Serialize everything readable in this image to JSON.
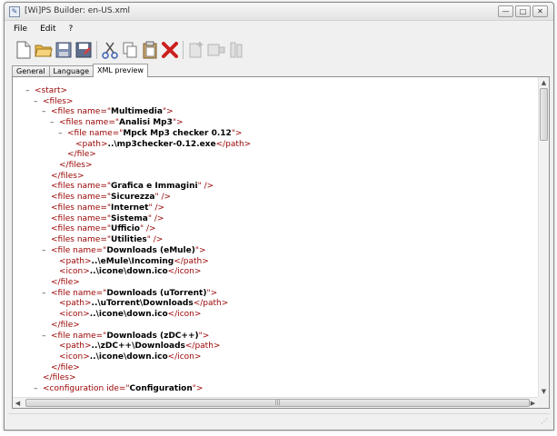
{
  "window": {
    "title": "[Wi]PS Builder: en-US.xml",
    "buttons": {
      "minimize": "—",
      "maximize": "□",
      "close": "✕"
    }
  },
  "menu": {
    "file": "File",
    "edit": "Edit",
    "help": "?"
  },
  "toolbar": {
    "icons": [
      "new-file-icon",
      "open-folder-icon",
      "save-icon",
      "save-as-icon",
      "cut-icon",
      "copy-icon",
      "paste-icon",
      "delete-icon",
      "add-item-icon",
      "add-child-icon",
      "properties-icon"
    ],
    "delete_color": "#cc1f1f"
  },
  "tabs": {
    "general": "General",
    "language": "Language",
    "xml_preview": "XML preview"
  },
  "xml_lines": [
    {
      "indent": 0,
      "toggle": "–",
      "parts": [
        [
          "tag",
          "<start>"
        ]
      ]
    },
    {
      "indent": 1,
      "toggle": "–",
      "parts": [
        [
          "tag",
          "<files>"
        ]
      ]
    },
    {
      "indent": 2,
      "toggle": "–",
      "parts": [
        [
          "tag",
          "<files "
        ],
        [
          "attr",
          "name=\""
        ],
        [
          "val",
          "Multimedia"
        ],
        [
          "attr",
          "\">"
        ]
      ]
    },
    {
      "indent": 3,
      "toggle": "–",
      "parts": [
        [
          "tag",
          "<files "
        ],
        [
          "attr",
          "name=\""
        ],
        [
          "val",
          "Analisi Mp3"
        ],
        [
          "attr",
          "\">"
        ]
      ]
    },
    {
      "indent": 4,
      "toggle": "–",
      "parts": [
        [
          "tag",
          "<file "
        ],
        [
          "attr",
          "name=\""
        ],
        [
          "val",
          "Mpck Mp3 checker 0.12"
        ],
        [
          "attr",
          "\">"
        ]
      ]
    },
    {
      "indent": 5,
      "toggle": "",
      "parts": [
        [
          "tag",
          "<path>"
        ],
        [
          "txt",
          "..\\mp3checker-0.12.exe"
        ],
        [
          "tag",
          "</path>"
        ]
      ]
    },
    {
      "indent": 4,
      "toggle": "",
      "parts": [
        [
          "tag",
          "</file>"
        ]
      ]
    },
    {
      "indent": 3,
      "toggle": "",
      "parts": [
        [
          "tag",
          "</files>"
        ]
      ]
    },
    {
      "indent": 2,
      "toggle": "",
      "parts": [
        [
          "tag",
          "</files>"
        ]
      ]
    },
    {
      "indent": 2,
      "toggle": "",
      "parts": [
        [
          "tag",
          "<files "
        ],
        [
          "attr",
          "name=\""
        ],
        [
          "val",
          "Grafica e Immagini"
        ],
        [
          "attr",
          "\" />"
        ]
      ]
    },
    {
      "indent": 2,
      "toggle": "",
      "parts": [
        [
          "tag",
          "<files "
        ],
        [
          "attr",
          "name=\""
        ],
        [
          "val",
          "Sicurezza"
        ],
        [
          "attr",
          "\" />"
        ]
      ]
    },
    {
      "indent": 2,
      "toggle": "",
      "parts": [
        [
          "tag",
          "<files "
        ],
        [
          "attr",
          "name=\""
        ],
        [
          "val",
          "Internet"
        ],
        [
          "attr",
          "\" />"
        ]
      ]
    },
    {
      "indent": 2,
      "toggle": "",
      "parts": [
        [
          "tag",
          "<files "
        ],
        [
          "attr",
          "name=\""
        ],
        [
          "val",
          "Sistema"
        ],
        [
          "attr",
          "\" />"
        ]
      ]
    },
    {
      "indent": 2,
      "toggle": "",
      "parts": [
        [
          "tag",
          "<files "
        ],
        [
          "attr",
          "name=\""
        ],
        [
          "val",
          "Ufficio"
        ],
        [
          "attr",
          "\" />"
        ]
      ]
    },
    {
      "indent": 2,
      "toggle": "",
      "parts": [
        [
          "tag",
          "<files "
        ],
        [
          "attr",
          "name=\""
        ],
        [
          "val",
          "Utilities"
        ],
        [
          "attr",
          "\" />"
        ]
      ]
    },
    {
      "indent": 2,
      "toggle": "–",
      "parts": [
        [
          "tag",
          "<file "
        ],
        [
          "attr",
          "name=\""
        ],
        [
          "val",
          "Downloads (eMule)"
        ],
        [
          "attr",
          "\">"
        ]
      ]
    },
    {
      "indent": 3,
      "toggle": "",
      "parts": [
        [
          "tag",
          "<path>"
        ],
        [
          "txt",
          "..\\eMule\\Incoming"
        ],
        [
          "tag",
          "</path>"
        ]
      ]
    },
    {
      "indent": 3,
      "toggle": "",
      "parts": [
        [
          "tag",
          "<icon>"
        ],
        [
          "txt",
          "..\\icone\\down.ico"
        ],
        [
          "tag",
          "</icon>"
        ]
      ]
    },
    {
      "indent": 2,
      "toggle": "",
      "parts": [
        [
          "tag",
          "</file>"
        ]
      ]
    },
    {
      "indent": 2,
      "toggle": "–",
      "parts": [
        [
          "tag",
          "<file "
        ],
        [
          "attr",
          "name=\""
        ],
        [
          "val",
          "Downloads (uTorrent)"
        ],
        [
          "attr",
          "\">"
        ]
      ]
    },
    {
      "indent": 3,
      "toggle": "",
      "parts": [
        [
          "tag",
          "<path>"
        ],
        [
          "txt",
          "..\\uTorrent\\Downloads"
        ],
        [
          "tag",
          "</path>"
        ]
      ]
    },
    {
      "indent": 3,
      "toggle": "",
      "parts": [
        [
          "tag",
          "<icon>"
        ],
        [
          "txt",
          "..\\icone\\down.ico"
        ],
        [
          "tag",
          "</icon>"
        ]
      ]
    },
    {
      "indent": 2,
      "toggle": "",
      "parts": [
        [
          "tag",
          "</file>"
        ]
      ]
    },
    {
      "indent": 2,
      "toggle": "–",
      "parts": [
        [
          "tag",
          "<file "
        ],
        [
          "attr",
          "name=\""
        ],
        [
          "val",
          "Downloads (zDC++)"
        ],
        [
          "attr",
          "\">"
        ]
      ]
    },
    {
      "indent": 3,
      "toggle": "",
      "parts": [
        [
          "tag",
          "<path>"
        ],
        [
          "txt",
          "..\\zDC++\\Downloads"
        ],
        [
          "tag",
          "</path>"
        ]
      ]
    },
    {
      "indent": 3,
      "toggle": "",
      "parts": [
        [
          "tag",
          "<icon>"
        ],
        [
          "txt",
          "..\\icone\\down.ico"
        ],
        [
          "tag",
          "</icon>"
        ]
      ]
    },
    {
      "indent": 2,
      "toggle": "",
      "parts": [
        [
          "tag",
          "</file>"
        ]
      ]
    },
    {
      "indent": 1,
      "toggle": "",
      "parts": [
        [
          "tag",
          "</files>"
        ]
      ]
    },
    {
      "indent": 1,
      "toggle": "–",
      "parts": [
        [
          "tag",
          "<configuration "
        ],
        [
          "attr",
          "ide=\""
        ],
        [
          "val",
          "Configuration"
        ],
        [
          "attr",
          "\">"
        ]
      ]
    }
  ],
  "colors": {
    "tag": "#990000",
    "value": "#000000",
    "window_bg": "#f0f0f0"
  }
}
